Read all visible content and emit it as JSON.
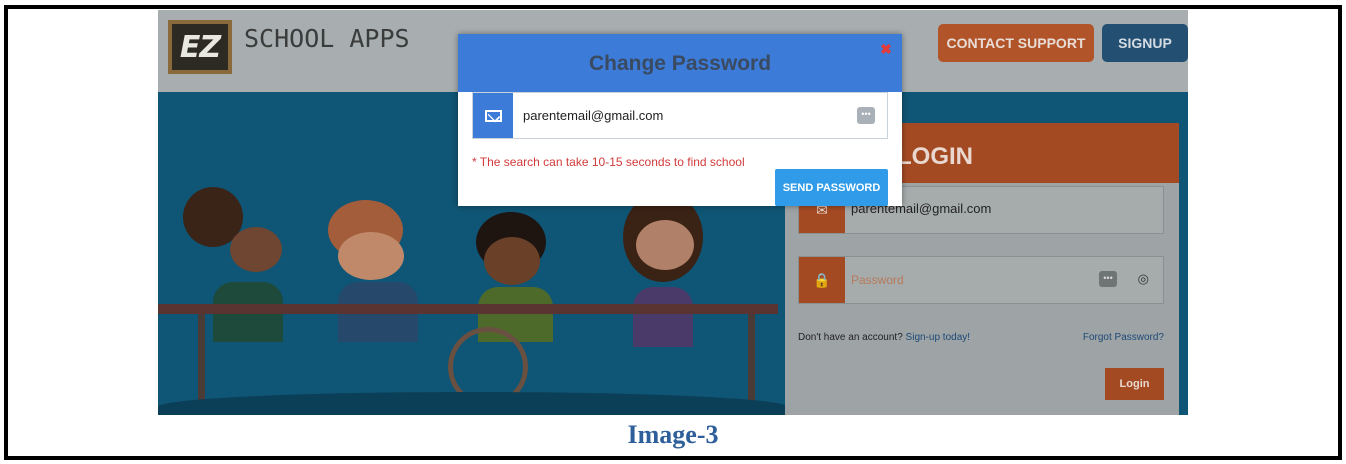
{
  "header": {
    "logo_mark": "EZ",
    "logo_text": "SCHOOL APPS",
    "contact_label": "CONTACT SUPPORT",
    "signup_label": "SIGNUP"
  },
  "login": {
    "title": "LOGIN",
    "email_value": "parentemail@gmail.com",
    "password_placeholder": "Password",
    "no_account_text": "Don't have an account?",
    "signup_link": "Sign-up today!",
    "forgot_link": "Forgot Password?",
    "login_label": "Login"
  },
  "modal": {
    "title": "Change Password",
    "close_icon": "close-icon",
    "email_value": "parentemail@gmail.com",
    "search_note": "* The search can take 10-15 seconds to find school",
    "send_label": "SEND PASSWORD"
  },
  "caption": "Image-3",
  "colors": {
    "modal_header": "#3d7bd8",
    "send_button": "#2f9be9",
    "note_text": "#d33a3a",
    "caption_text": "#2f5f9a"
  }
}
